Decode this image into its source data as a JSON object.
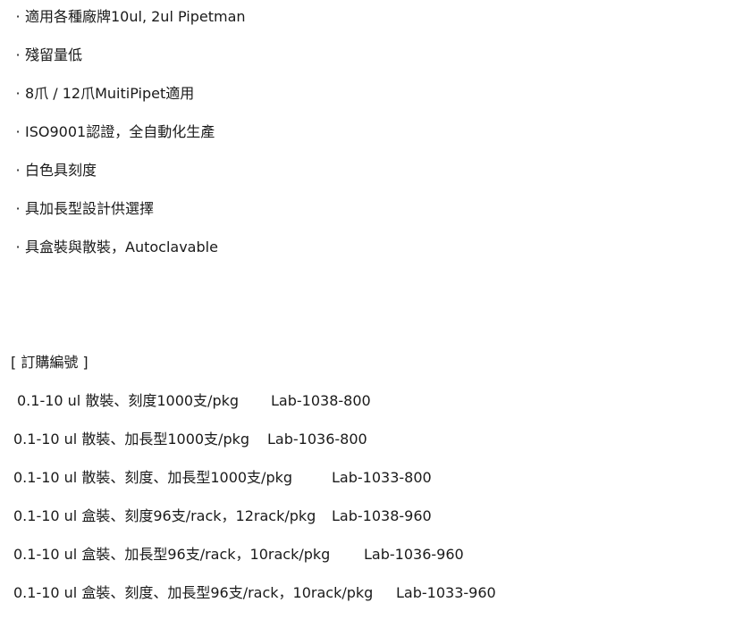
{
  "features": [
    {
      "bullet": "·",
      "text": "適用各種廠牌10ul, 2ul Pipetman"
    },
    {
      "bullet": "·",
      "text": "殘留量低"
    },
    {
      "bullet": "·",
      "text": "8爪 / 12爪MuitiPipet適用"
    },
    {
      "bullet": "·",
      "text": "ISO9001認證，全自動化生產"
    },
    {
      "bullet": "·",
      "text": "白色具刻度"
    },
    {
      "bullet": "·",
      "text": "具加長型設計供選擇"
    },
    {
      "bullet": "·",
      "text": "具盒裝與散裝，Autoclavable"
    }
  ],
  "order": {
    "title": "[ 訂購編號 ]",
    "rows": [
      {
        "spec": "0.1-10 ul 散裝、刻度1000支/pkg",
        "code": "Lab-1038-800"
      },
      {
        "spec": "0.1-10 ul 散裝、加長型1000支/pkg",
        "code": "Lab-1036-800"
      },
      {
        "spec": "0.1-10 ul 散裝、刻度、加長型1000支/pkg",
        "code": "Lab-1033-800"
      },
      {
        "spec": "0.1-10 ul 盒裝、刻度96支/rack，12rack/pkg",
        "code": "Lab-1038-960"
      },
      {
        "spec": "0.1-10 ul 盒裝、加長型96支/rack，10rack/pkg",
        "code": "Lab-1036-960"
      },
      {
        "spec": "0.1-10 ul 盒裝、刻度、加長型96支/rack，10rack/pkg",
        "code": "Lab-1033-960"
      }
    ]
  }
}
